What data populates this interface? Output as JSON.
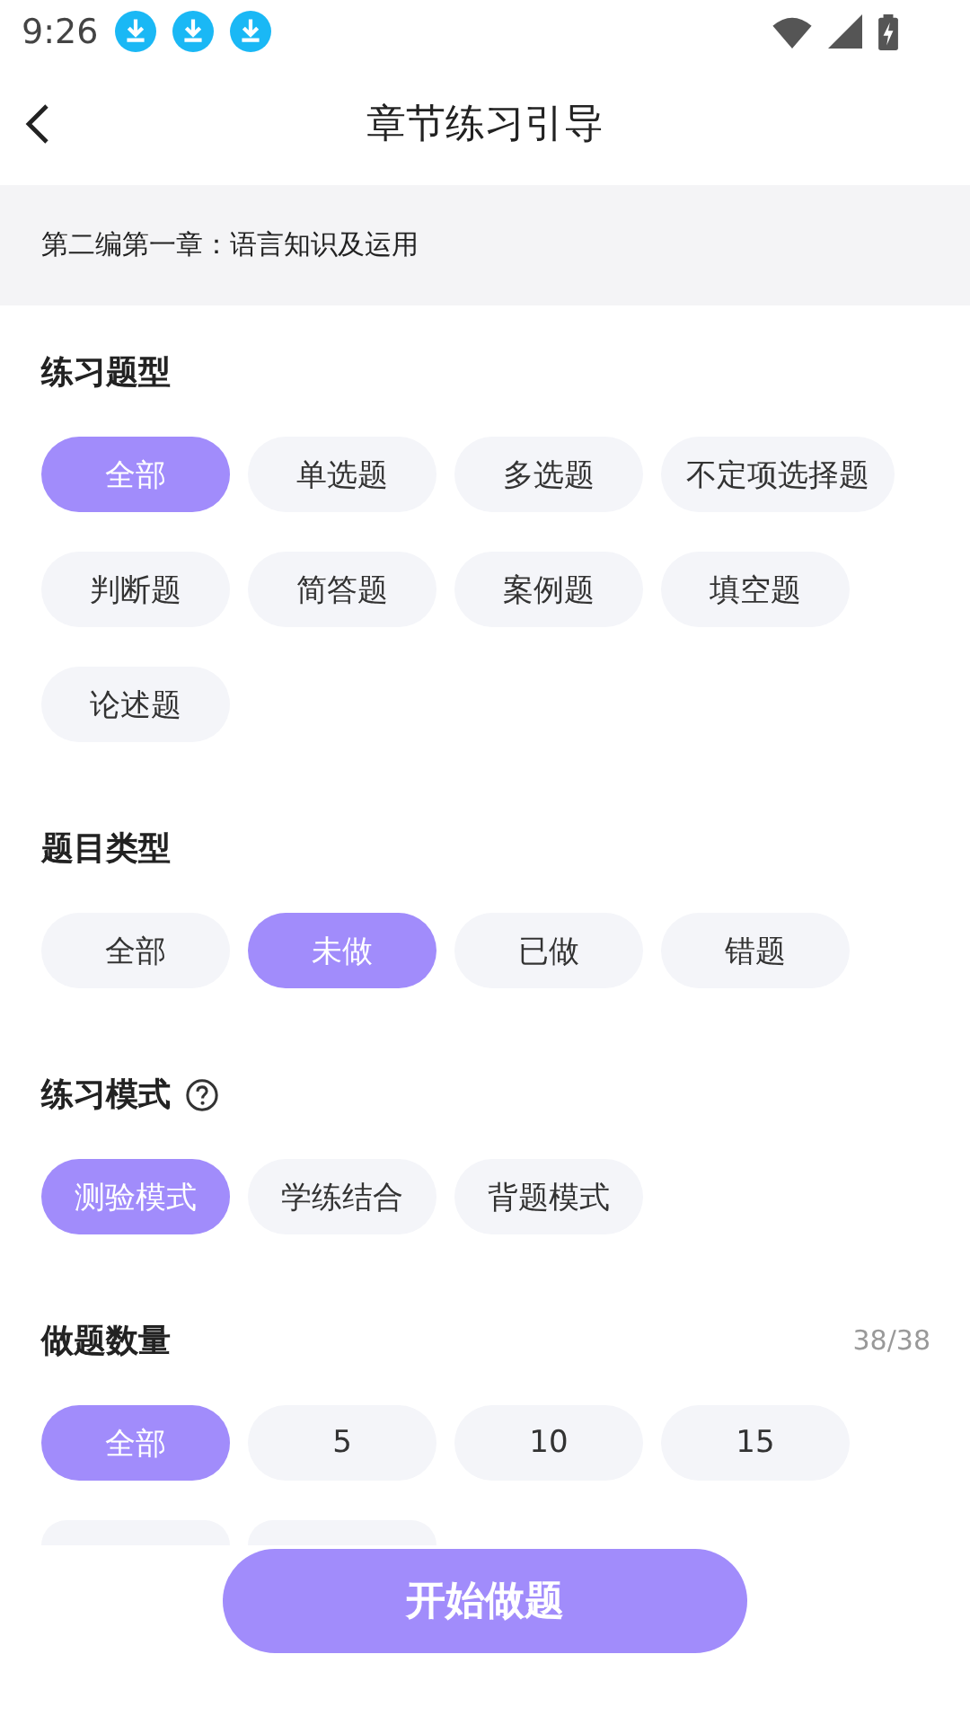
{
  "status_bar": {
    "time": "9:26",
    "notifications": [
      {
        "kind": "download"
      },
      {
        "kind": "download"
      },
      {
        "kind": "download"
      }
    ]
  },
  "header": {
    "title": "章节练习引导"
  },
  "chapter": "第二编第一章：语言知识及运用",
  "sections": [
    {
      "title": "练习题型",
      "help": false,
      "options": [
        {
          "label": "全部",
          "selected": true
        },
        {
          "label": "单选题",
          "selected": false
        },
        {
          "label": "多选题",
          "selected": false
        },
        {
          "label": "不定项选择题",
          "selected": false
        },
        {
          "label": "判断题",
          "selected": false
        },
        {
          "label": "简答题",
          "selected": false
        },
        {
          "label": "案例题",
          "selected": false
        },
        {
          "label": "填空题",
          "selected": false
        },
        {
          "label": "论述题",
          "selected": false
        }
      ]
    },
    {
      "title": "题目类型",
      "help": false,
      "options": [
        {
          "label": "全部",
          "selected": false
        },
        {
          "label": "未做",
          "selected": true
        },
        {
          "label": "已做",
          "selected": false
        },
        {
          "label": "错题",
          "selected": false
        }
      ]
    },
    {
      "title": "练习模式",
      "help": true,
      "options": [
        {
          "label": "测验模式",
          "selected": true
        },
        {
          "label": "学练结合",
          "selected": false
        },
        {
          "label": "背题模式",
          "selected": false
        }
      ]
    },
    {
      "title": "做题数量",
      "help": false,
      "count": "38/38",
      "options": [
        {
          "label": "全部",
          "selected": true
        },
        {
          "label": "5",
          "selected": false
        },
        {
          "label": "10",
          "selected": false
        },
        {
          "label": "15",
          "selected": false
        },
        {
          "kind": "cut",
          "selected": false
        },
        {
          "kind": "cut",
          "selected": false
        }
      ]
    }
  ],
  "start_button": "开始做题"
}
